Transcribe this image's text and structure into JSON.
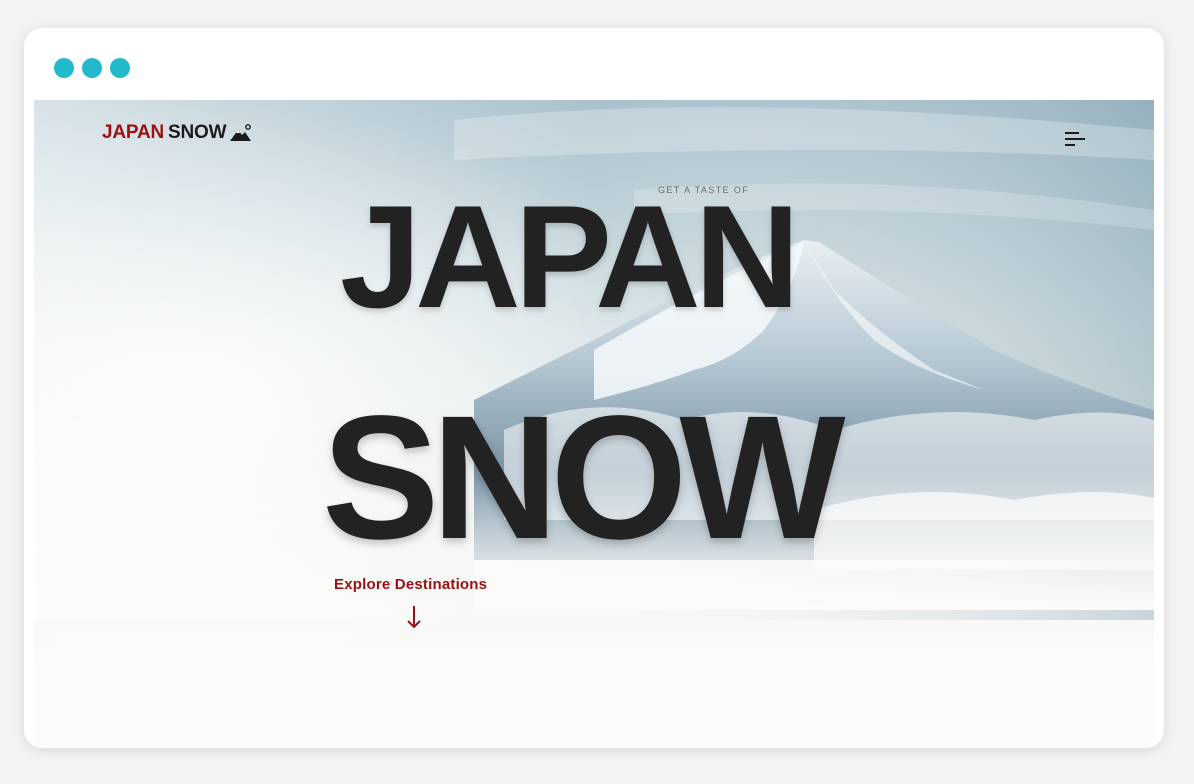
{
  "header": {
    "logo_part1": "JAPAN",
    "logo_part2": "SNOW",
    "logo_icon": "mountain-icon",
    "menu_icon": "menu-icon"
  },
  "hero": {
    "eyebrow": "GET A TASTE OF",
    "title_line1": "JAPAN",
    "title_line2": "SNOW",
    "cta_label": "Explore Destinations",
    "cta_icon": "arrow-down-icon"
  },
  "colors": {
    "accent_red": "#9b1111",
    "text_dark": "#222222",
    "window_dots": "#22b9cc"
  }
}
